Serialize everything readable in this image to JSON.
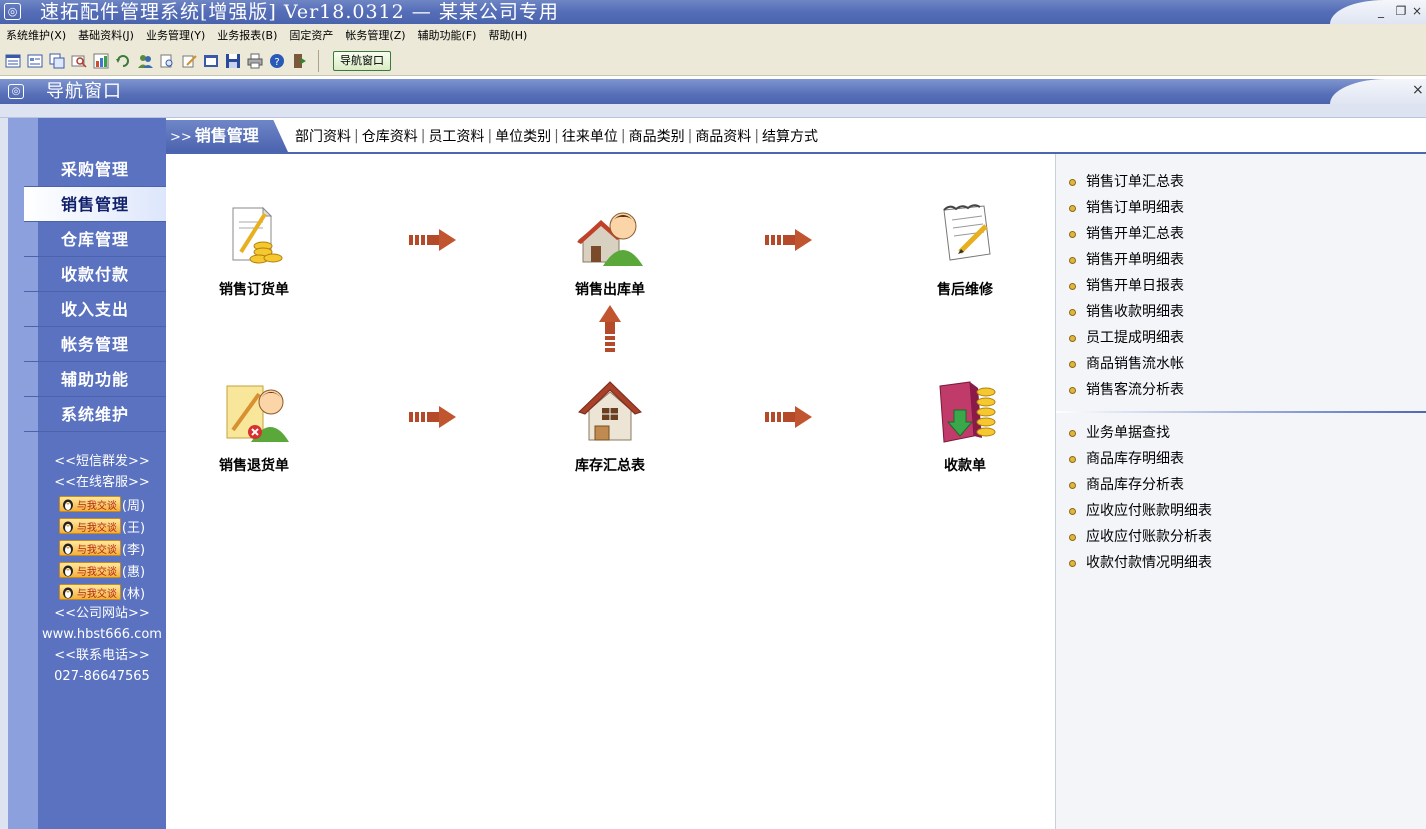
{
  "window": {
    "title": "速拓配件管理系统[增强版] Ver18.0312 — 某某公司专用",
    "minimize": "_",
    "restore": "❐",
    "close": "×"
  },
  "menu": [
    "系统维护(X)",
    "基础资料(J)",
    "业务管理(Y)",
    "业务报表(B)",
    "固定资产",
    "帐务管理(Z)",
    "辅助功能(F)",
    "帮助(H)"
  ],
  "toolbar": {
    "icons": [
      "list-icon",
      "form-icon",
      "copy-icon",
      "find-icon",
      "chart-icon",
      "refresh-icon",
      "users-icon",
      "print-preview-icon",
      "edit-icon",
      "window-icon",
      "save-icon",
      "print-icon",
      "help-icon",
      "exit-icon"
    ],
    "nav_window_label": "导航窗口"
  },
  "child_window": {
    "title": "导航窗口",
    "close": "×"
  },
  "sidebar": {
    "items": [
      {
        "label": "采购管理",
        "active": false
      },
      {
        "label": "销售管理",
        "active": true
      },
      {
        "label": "仓库管理",
        "active": false
      },
      {
        "label": "收款付款",
        "active": false
      },
      {
        "label": "收入支出",
        "active": false
      },
      {
        "label": "帐务管理",
        "active": false
      },
      {
        "label": "辅助功能",
        "active": false
      },
      {
        "label": "系统维护",
        "active": false
      }
    ],
    "sms": "<<短信群发>>",
    "online_service": "<<在线客服>>",
    "qq_badge": "与我交谈",
    "qq_contacts": [
      "(周)",
      "(王)",
      "(李)",
      "(惠)",
      "(林)"
    ],
    "website_label": "<<公司网站>>",
    "website": "www.hbst666.com",
    "phone_label": "<<联系电话>>",
    "phone": "027-86647565"
  },
  "category_bar": {
    "prefix": ">>",
    "active": "销售管理",
    "links": [
      "部门资料",
      "仓库资料",
      "员工资料",
      "单位类别",
      "往来单位",
      "商品类别",
      "商品资料",
      "结算方式"
    ]
  },
  "flow": {
    "sales_order": "销售订货单",
    "sales_out": "销售出库单",
    "after_sales": "售后维修",
    "sales_return": "销售退货单",
    "stock_summary": "库存汇总表",
    "receipt": "收款单"
  },
  "reports": {
    "group1": [
      "销售订单汇总表",
      "销售订单明细表",
      "销售开单汇总表",
      "销售开单明细表",
      "销售开单日报表",
      "销售收款明细表",
      "员工提成明细表",
      "商品销售流水帐",
      "销售客流分析表"
    ],
    "group2": [
      "业务单据查找",
      "商品库存明细表",
      "商品库存分析表",
      "应收应付账款明细表",
      "应收应付账款分析表",
      "收款付款情况明细表"
    ]
  },
  "colors": {
    "accent_blue": "#4b63ae",
    "sidebar_blue": "#5a72c0",
    "arrow_red": "#b44a2a",
    "bullet_gold": "#e2b53c"
  }
}
